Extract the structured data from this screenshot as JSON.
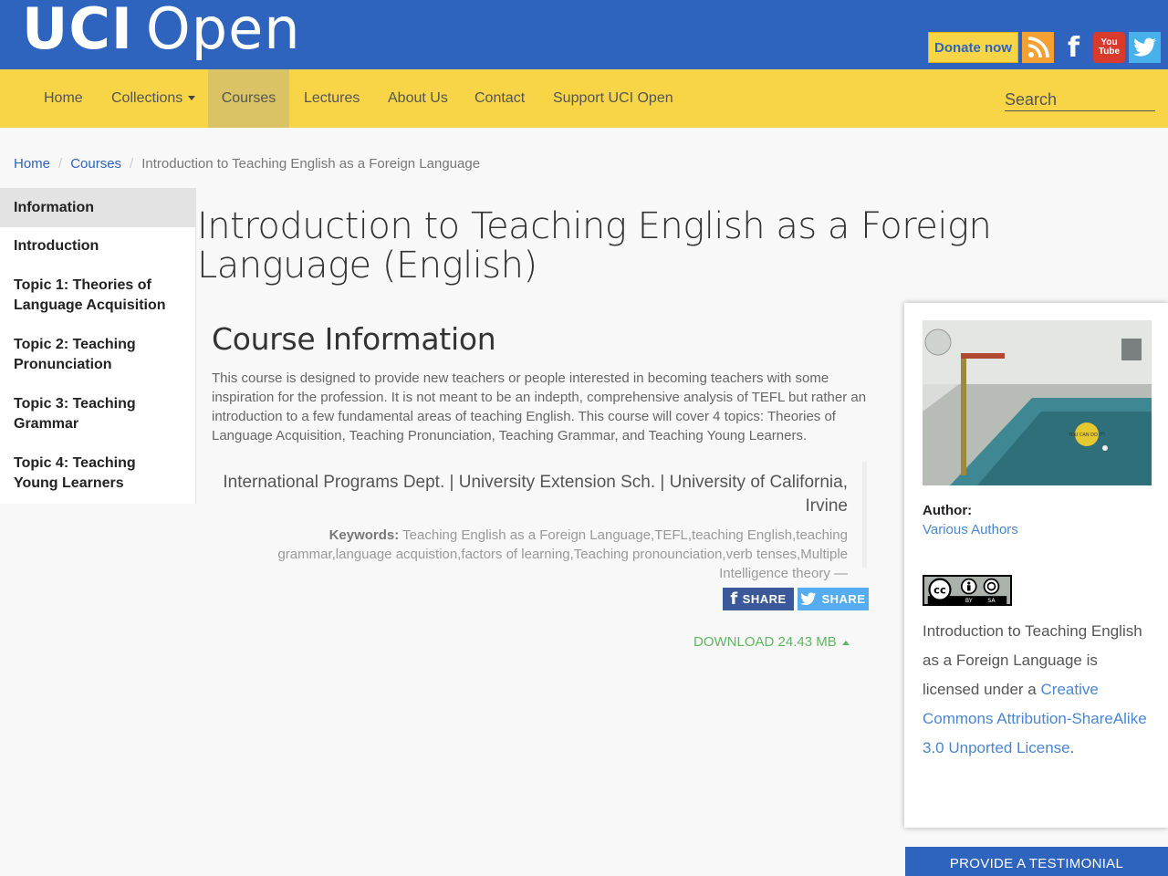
{
  "header": {
    "logo_bold": "UCI",
    "logo_light": "Open",
    "donate_label": "Donate now",
    "social": {
      "rss_icon": "rss-icon",
      "facebook_glyph": "f",
      "youtube_top": "You",
      "youtube_bottom": "Tube",
      "twitter_icon": "twitter-icon"
    }
  },
  "nav": {
    "items": [
      "Home",
      "Collections",
      "Courses",
      "Lectures",
      "About Us",
      "Contact",
      "Support UCI Open"
    ],
    "active": "Courses",
    "search_placeholder": "Search"
  },
  "breadcrumb": {
    "home": "Home",
    "courses": "Courses",
    "current": "Introduction to Teaching English as a Foreign Language"
  },
  "sidebar": {
    "items": [
      "Information",
      "Introduction",
      "Topic 1: Theories of Language Acquisition",
      "Topic 2: Teaching Pronunciation",
      "Topic 3: Teaching Grammar",
      "Topic 4: Teaching Young Learners"
    ]
  },
  "main": {
    "title": "Introduction to Teaching English as a Foreign Language (English)",
    "section_title": "Course Information",
    "description": "This course is designed to provide new teachers or people interested in becoming teachers with some inspiration for the profession. It is not meant to be an indepth, comprehensive analysis of TEFL but rather an introduction to a few fundamental areas of teaching English. This course will cover 4 topics: Theories of Language Acquisition, Teaching Pronunciation, Teaching Grammar, and Teaching Young Learners.",
    "department": "International Programs Dept. | University Extension Sch. | University of California, Irvine",
    "keywords_label": "Keywords:",
    "keywords": "Teaching English as a Foreign Language,TEFL,teaching English,teaching grammar,language acquistion,factors of learning,Teaching pronounciation,verb tenses,Multiple Intelligence theory —",
    "share_label": "SHARE",
    "download": "DOWNLOAD 24.43 MB"
  },
  "card": {
    "image_caption": "YOU CAN DO IT!",
    "author_label": "Author:",
    "author": "Various Authors",
    "license_pre": "Introduction to Teaching English as a Foreign Language is licensed under a",
    "license_link": "Creative Commons Attribution-ShareAlike 3.0 Unported License",
    "license_post": ".",
    "cc_by": "BY",
    "cc_sa": "SA"
  },
  "testimonial_label": "PROVIDE A TESTIMONIAL",
  "colors": {
    "primary_blue": "#2f64be",
    "nav_yellow": "#f7d547",
    "download_green": "#5cb85c",
    "link_blue": "#4a86d4"
  }
}
